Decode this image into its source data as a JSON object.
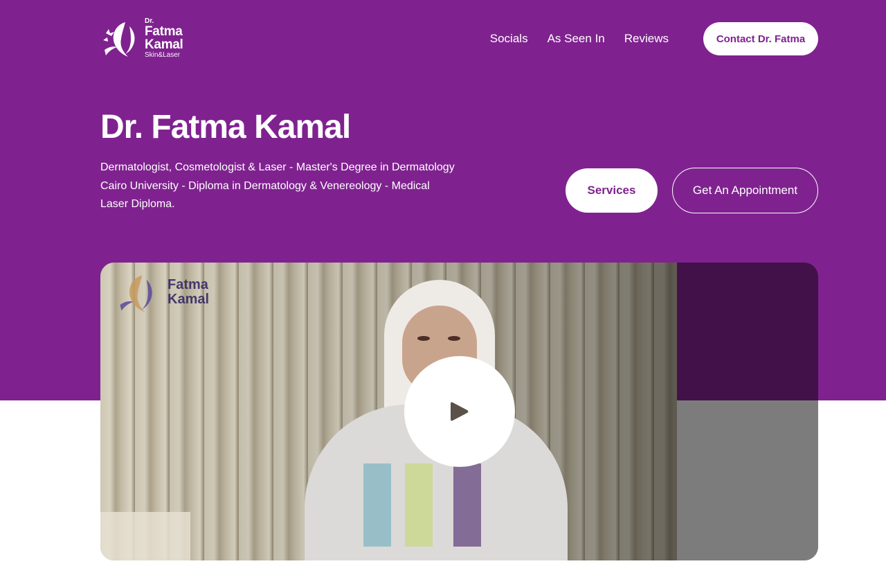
{
  "brand": {
    "logo_dr": "Dr.",
    "logo_first": "Fatma",
    "logo_last": "Kamal",
    "logo_sub": "Skin&Laser"
  },
  "nav": {
    "items": [
      {
        "label": "Socials"
      },
      {
        "label": "As Seen In"
      },
      {
        "label": "Reviews"
      }
    ],
    "cta_label": "Contact Dr. Fatma"
  },
  "hero": {
    "title": "Dr. Fatma Kamal",
    "description": "Dermatologist, Cosmetologist & Laser - Master's Degree in Dermatology Cairo University - Diploma in Dermatology & Venereology - Medical Laser Diploma.",
    "primary_button": "Services",
    "secondary_button": "Get An Appointment"
  },
  "video": {
    "watermark_first": "Fatma",
    "watermark_last": "Kamal",
    "play_icon": "play-icon"
  },
  "colors": {
    "brand_purple": "#7f228f",
    "dark_purple": "#42114a",
    "white": "#ffffff"
  }
}
